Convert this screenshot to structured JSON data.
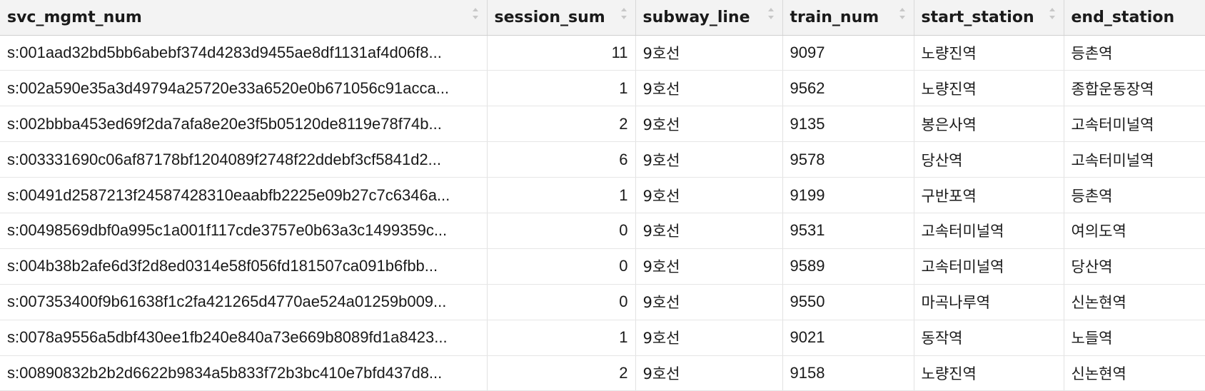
{
  "columns": [
    {
      "label": "svc_mgmt_num",
      "sortable": true
    },
    {
      "label": "session_sum",
      "sortable": true
    },
    {
      "label": "subway_line",
      "sortable": true
    },
    {
      "label": "train_num",
      "sortable": true
    },
    {
      "label": "start_station",
      "sortable": true
    },
    {
      "label": "end_station",
      "sortable": false
    }
  ],
  "rows": [
    [
      "s:001aad32bd5bb6abebf374d4283d9455ae8df1131af4d06f8...",
      "11",
      "9호선",
      "9097",
      "노량진역",
      "등촌역"
    ],
    [
      "s:002a590e35a3d49794a25720e33a6520e0b671056c91acca...",
      "1",
      "9호선",
      "9562",
      "노량진역",
      "종합운동장역"
    ],
    [
      "s:002bbba453ed69f2da7afa8e20e3f5b05120de8119e78f74b...",
      "2",
      "9호선",
      "9135",
      "봉은사역",
      "고속터미널역"
    ],
    [
      "s:003331690c06af87178bf1204089f2748f22ddebf3cf5841d2...",
      "6",
      "9호선",
      "9578",
      "당산역",
      "고속터미널역"
    ],
    [
      "s:00491d2587213f24587428310eaabfb2225e09b27c7c6346a...",
      "1",
      "9호선",
      "9199",
      "구반포역",
      "등촌역"
    ],
    [
      "s:00498569dbf0a995c1a001f117cde3757e0b63a3c1499359c...",
      "0",
      "9호선",
      "9531",
      "고속터미널역",
      "여의도역"
    ],
    [
      "s:004b38b2afe6d3f2d8ed0314e58f056fd181507ca091b6fbb...",
      "0",
      "9호선",
      "9589",
      "고속터미널역",
      "당산역"
    ],
    [
      "s:007353400f9b61638f1c2fa421265d4770ae524a01259b009...",
      "0",
      "9호선",
      "9550",
      "마곡나루역",
      "신논현역"
    ],
    [
      "s:0078a9556a5dbf430ee1fb240e840a73e669b8089fd1a8423...",
      "1",
      "9호선",
      "9021",
      "동작역",
      "노들역"
    ],
    [
      "s:00890832b2b2d6622b9834a5b833f72b3bc410e7bfd437d8...",
      "2",
      "9호선",
      "9158",
      "노량진역",
      "신논현역"
    ]
  ]
}
